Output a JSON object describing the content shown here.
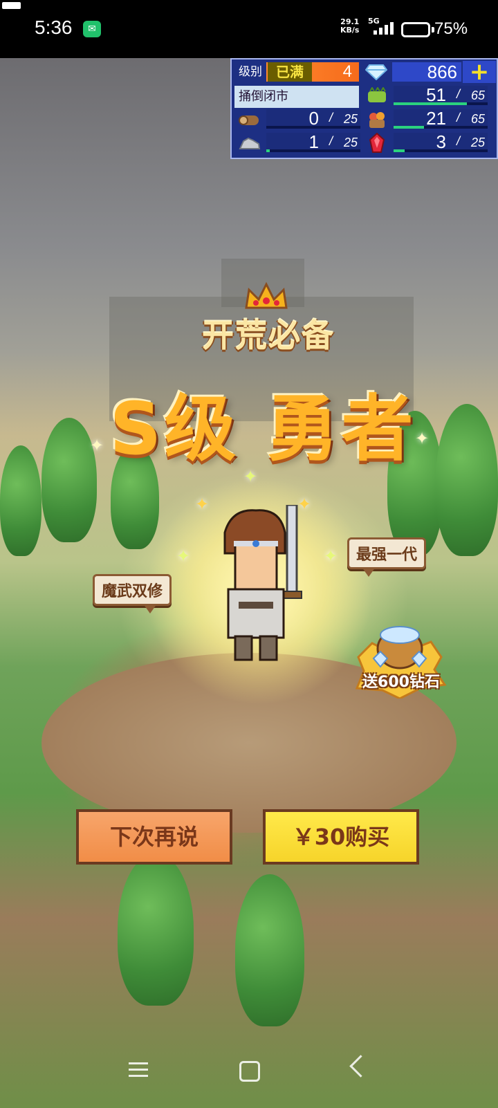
{
  "status_bar": {
    "time": "5:36",
    "net_speed_value": "29.1",
    "net_speed_unit": "KB/s",
    "network_type": "5G",
    "battery": "75%",
    "battery_level": 0.75
  },
  "hud": {
    "level_label": "级别",
    "level_status": "已满",
    "level_value": "4",
    "diamonds": "866",
    "status_message": "捅倒闭市",
    "resources": [
      {
        "name": "grass",
        "icon": "grass-icon",
        "current": "51",
        "max": "65",
        "fill": 0.78
      },
      {
        "name": "wood",
        "icon": "wood-log-icon",
        "current": "0",
        "max": "25",
        "fill": 0.0
      },
      {
        "name": "food",
        "icon": "food-basket-icon",
        "current": "21",
        "max": "65",
        "fill": 0.32
      },
      {
        "name": "ore",
        "icon": "ore-rock-icon",
        "current": "1",
        "max": "25",
        "fill": 0.04
      },
      {
        "name": "gem",
        "icon": "red-gem-icon",
        "current": "3",
        "max": "25",
        "fill": 0.12
      }
    ]
  },
  "promo": {
    "badge": "开荒必备",
    "title": "S级 勇者",
    "tag_left": "魔武双修",
    "tag_right": "最强一代",
    "gift": "送600钻石"
  },
  "buttons": {
    "cancel": "下次再说",
    "buy": "￥30购买"
  },
  "colors": {
    "hud_bg": "#1d2f83",
    "bar_fill": "#2bd27e",
    "buy_button": "#f6d42a",
    "cancel_button": "#f18d47"
  }
}
